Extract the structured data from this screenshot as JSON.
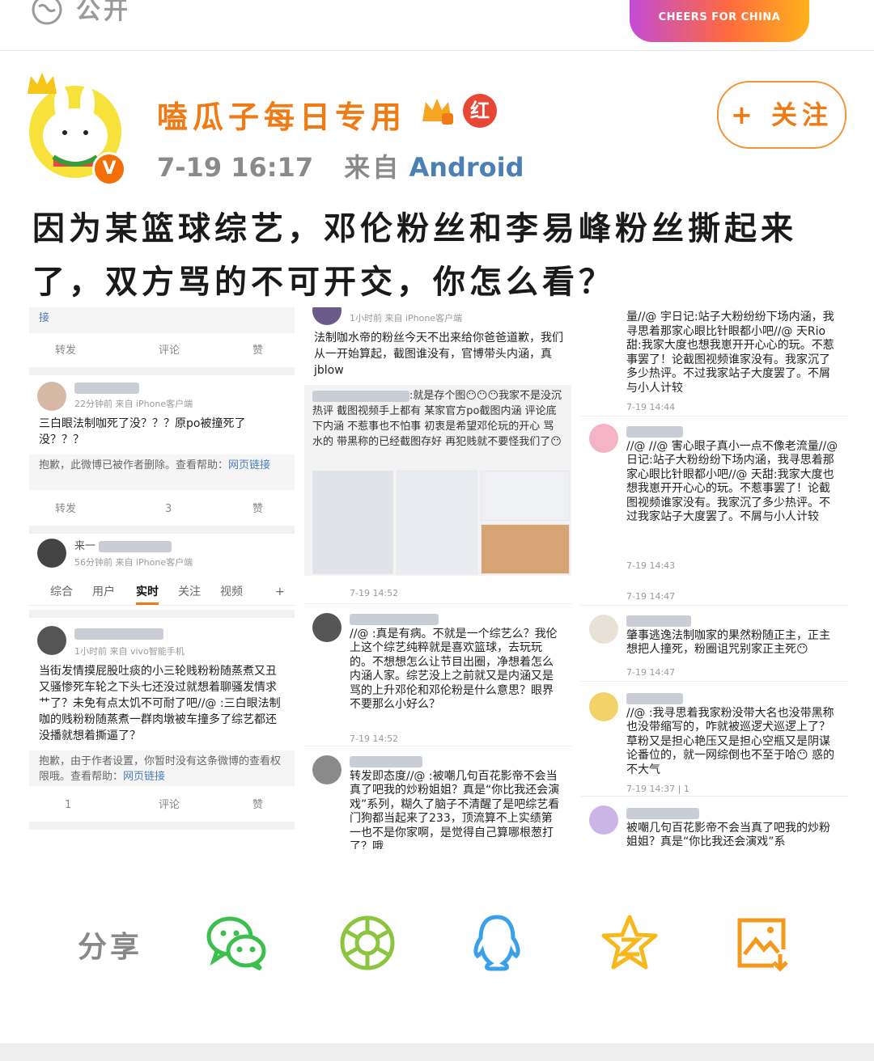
{
  "top": {
    "visibility": "公开",
    "banner_text": "CHEERS FOR CHINA"
  },
  "author": {
    "name": "嗑瓜子每日专用",
    "badge_red": "红",
    "time": "7-19 16:17",
    "from_label": "来自",
    "source": "Android",
    "follow": "+ 关注"
  },
  "post": {
    "text": "因为某篮球综艺，邓伦粉丝和李易峰粉丝撕起来了，双方骂的不可开交，你怎么看？"
  },
  "screenshot_left": {
    "top_link": "接",
    "actions1": {
      "repost": "转发",
      "comment": "评论",
      "like": "赞"
    },
    "post1_meta": "22分钟前  来自 iPhone客户端",
    "post1_text": "三白眼法制咖死了没？？？原po被撞死了没？？？",
    "deleted_notice": "抱歉，此微博已被作者删除。查看帮助：",
    "help_link": "网页链接",
    "actions2": {
      "repost": "转发",
      "comment": "3",
      "like": "赞"
    },
    "post2_name": "来一",
    "post2_meta": "56分钟前  来自 iPhone客户端",
    "tabs": [
      "综合",
      "用户",
      "实时",
      "关注",
      "视频",
      "+"
    ],
    "post3_meta": "1小时前  来自 vivo智能手机",
    "post3_text": "当街发情摸屁股吐痰的小三轮贱粉粉随蒸煮又丑又骚惨死车轮之下头七还没过就想着聊骚发情求艹了？未免有点太饥不可耐了吧//@    :三白眼法制咖的贱粉粉随蒸煮一群肉墩被车撞多了综艺都还没播就想着撕逼了？",
    "restricted_notice": "抱歉，由于作者设置，你暂时没有这条微博的查看权限哦。查看帮助：",
    "actions3": {
      "repost": "1",
      "comment": "评论",
      "like": "赞"
    }
  },
  "screenshot_mid": {
    "meta": "1小时前  来自 iPhone客户端",
    "text1": "法制咖水帝的粉丝今天不出来给你爸爸道歉，我们从一开始算起，截图谁没有，官博带头内涵，真jblow",
    "quote": ":就是存个图😶😶😶我家不是没沉热评 截图视频手上都有 某家官方po截图内涵 评论底下内涵 不惹事也不怕事 初衷是希望邓伦玩的开心 骂水的 带黑称的已经截图存好 再犯贱就不要怪我们了😶",
    "ts1": "7-19 14:52",
    "c1": "//@    :真是有病。不就是一个综艺么？我伦上这个综艺纯粹就是喜欢篮球，去玩玩的。不想想怎么让节目出圈，净想着怎么内涵人家。综艺没上之前就又是内涵又是骂的上升邓伦和邓伦粉是什么意思？眼界不要那么小好么？",
    "ts2": "7-19 14:52",
    "c2": "转发即态度//@    :被嘲几句百花影帝不会当真了吧我的炒粉姐姐？真是“你比我还会演戏”系列，糊久了脑子不清醒了是吧综艺看门狗都当起来了233，顶流算不上实绩第一也不是你家啊，是觉得自己算哪根葱打了？哦"
  },
  "screenshot_right": {
    "c0": "量//@    宇日记:站子大粉纷纷下场内涵，我寻思着那家心眼比针眼都小吧//@    天Rio甜:我家大度也想我崽开开心心的玩。不惹事罢了！论截图视频谁家没有。我家沉了多少热评。不过我家站子大度罢了。不屑与小人计较",
    "ts0": "7-19 14:44",
    "c1": "//@    //@    害心眼子真小一点不像老流量//@    日记:站子大粉纷纷下场内涵，我寻思着那家心眼比针眼都小吧//@    天甜:我家大度也想我崽开开心心的玩。不惹事罢了！论截图视频谁家没有。我家沉了多少热评。不过我家站子大度罢了。不屑与小人计较",
    "ts1": "7-19 14:43",
    "ts1b": "7-19 14:47",
    "c2": "肇事逃逸法制咖家的果然粉随正主，正主想把人撞死，粉圈诅咒别家正主死😶",
    "ts2": "7-19 14:47",
    "c3": "//@    :我寻思着我家粉没带大名也没带黑称也没带缩写的，咋就被巡逻犬巡逻上了？草粉又是担心艳压又是担心空瓶又是阴谋论番位的，就一网综倒也不至于哈😶 惑的不大气",
    "ts3": "7-19 14:37  |  1",
    "c4": "被嘲几句百花影帝不会当真了吧我的炒粉姐姐？真是“你比我还会演戏”系"
  },
  "share": {
    "label": "分享"
  },
  "colors": {
    "accent": "#f07a14",
    "link": "#4c7fb4"
  }
}
